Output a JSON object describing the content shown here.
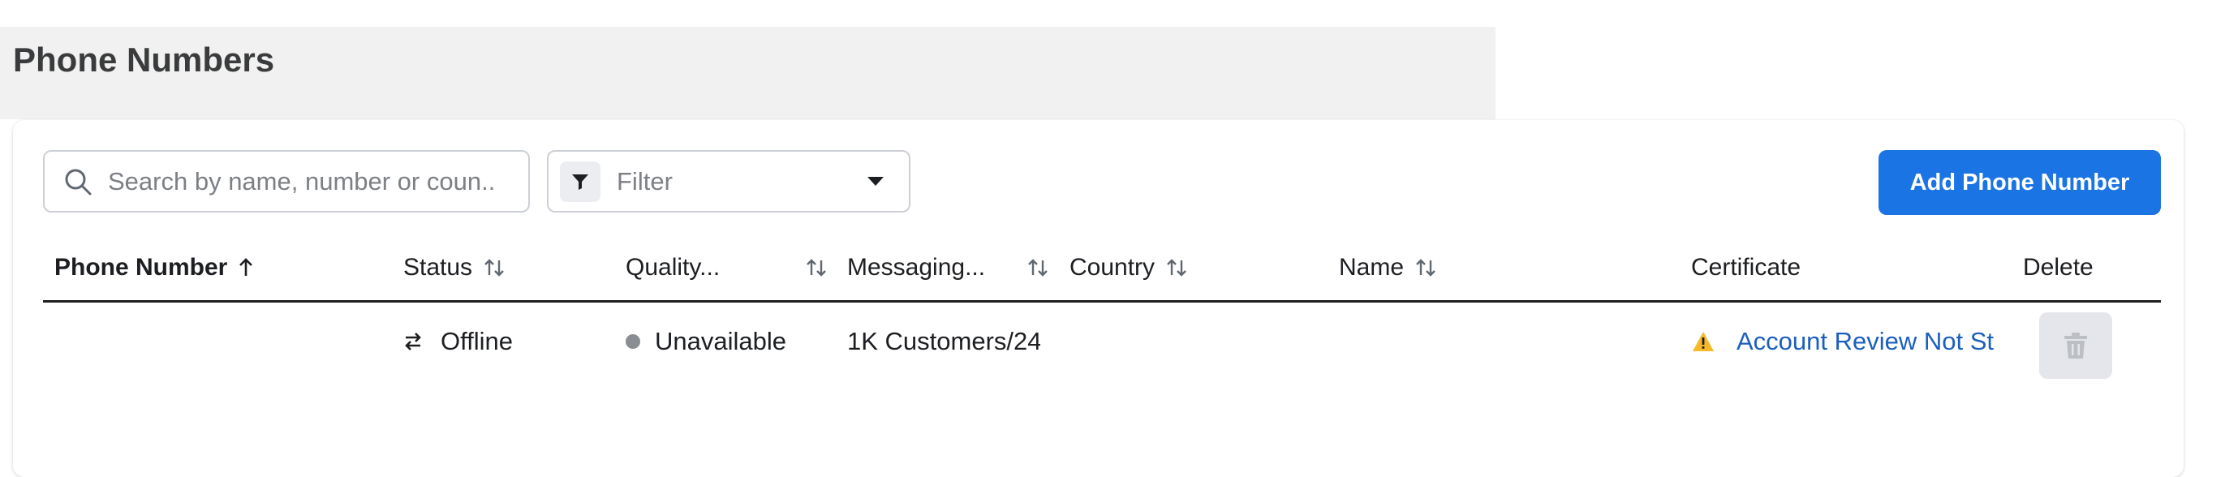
{
  "page": {
    "title": "Phone Numbers"
  },
  "toolbar": {
    "search_placeholder": "Search by name, number or coun...",
    "filter_label": "Filter",
    "add_button_label": "Add Phone Number"
  },
  "table": {
    "columns": [
      {
        "label": "Phone Number",
        "sort": "ascending",
        "icon": "arrow-up-icon"
      },
      {
        "label": "Status",
        "sort": "sortable",
        "icon": "sort-icon"
      },
      {
        "label": "Quality...",
        "sort": "sortable",
        "icon": "sort-icon"
      },
      {
        "label": "Messaging...",
        "sort": "sortable",
        "icon": "sort-icon"
      },
      {
        "label": "Country",
        "sort": "sortable",
        "icon": "sort-icon"
      },
      {
        "label": "Name",
        "sort": "sortable",
        "icon": "sort-icon"
      },
      {
        "label": "Certificate",
        "sort": "none"
      },
      {
        "label": "Delete",
        "sort": "none"
      }
    ],
    "rows": [
      {
        "phone_number": "",
        "status": "Offline",
        "status_icon": "swap-arrows-icon",
        "quality": "Unavailable",
        "quality_color": "#8a8d91",
        "messaging": "1K Customers/24",
        "country": "",
        "name": "",
        "certificate": "Account Review Not St",
        "certificate_icon": "warning-icon",
        "certificate_icon_color": "#f7b928",
        "delete_icon": "trash-icon",
        "delete_disabled": true
      }
    ]
  },
  "colors": {
    "primary": "#1b74e4",
    "link": "#1b5fbd",
    "warning": "#f7b928"
  }
}
